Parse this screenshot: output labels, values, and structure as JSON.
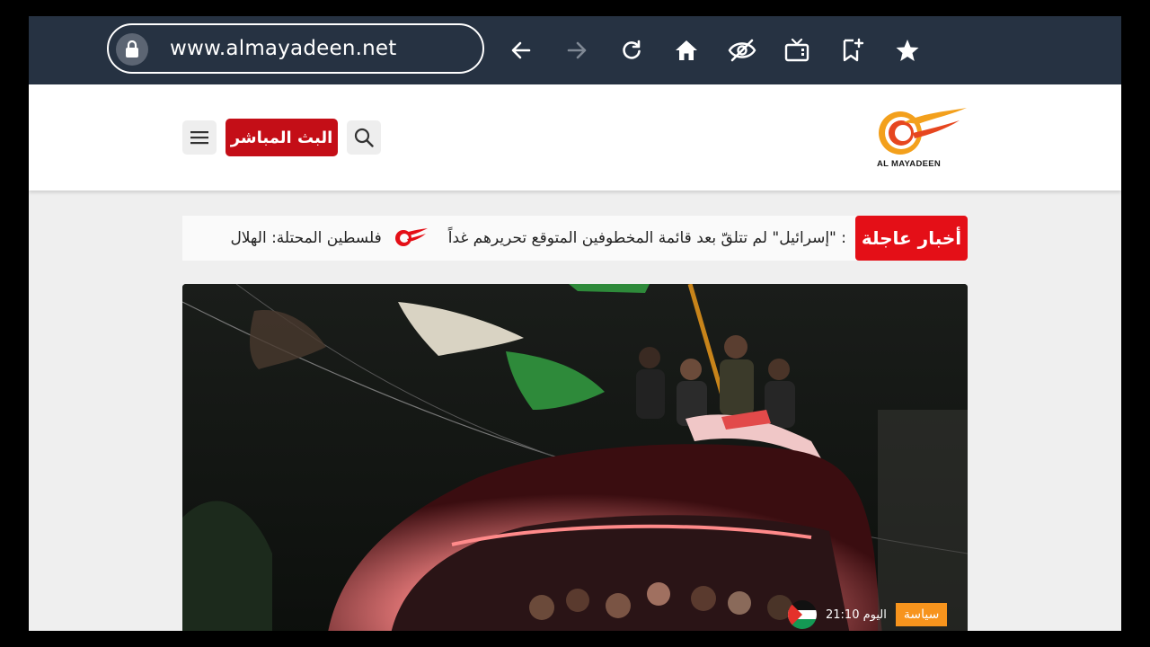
{
  "browser": {
    "url": "www.almayadeen.net",
    "icons": [
      "lock-icon",
      "back-arrow-icon",
      "forward-arrow-icon",
      "reload-icon",
      "home-icon",
      "eye-off-icon",
      "tv-icon",
      "bookmark-add-icon",
      "star-icon"
    ],
    "toolbar_color": "#263242"
  },
  "header": {
    "live_label": "البث المباشر",
    "logo_text": "AL MAYADEEN",
    "accent": "#c40e17"
  },
  "ticker": {
    "label": "أخبار عاجلة",
    "items": [
      ": \"إسرائيل\" لم تتلقّ بعد قائمة المخطوفين المتوقع تحريرهم غداً",
      "فلسطين المحتلة: الهلال"
    ],
    "label_color": "#e40f17"
  },
  "article": {
    "category": "سياسة",
    "date": "اليوم 21:10",
    "category_color": "#f7941d"
  }
}
